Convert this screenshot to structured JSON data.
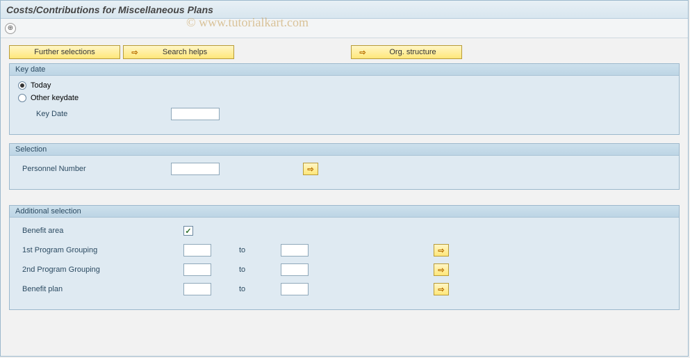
{
  "window": {
    "title": "Costs/Contributions for Miscellaneous Plans"
  },
  "watermark": "© www.tutorialkart.com",
  "buttons": {
    "further_selections": "Further selections",
    "search_helps": "Search helps",
    "org_structure": "Org. structure"
  },
  "group_keydate": {
    "title": "Key date",
    "opt_today": "Today",
    "opt_other": "Other keydate",
    "label_keydate": "Key Date",
    "value_keydate": "",
    "selected": "today"
  },
  "group_selection": {
    "title": "Selection",
    "label_pernr": "Personnel Number",
    "value_pernr": ""
  },
  "group_additional": {
    "title": "Additional selection",
    "rows": {
      "benefit_area": {
        "label": "Benefit area",
        "checked": true
      },
      "pg1": {
        "label": "1st Program Grouping",
        "from": "",
        "to_lbl": "to",
        "to": ""
      },
      "pg2": {
        "label": "2nd Program Grouping",
        "from": "",
        "to_lbl": "to",
        "to": ""
      },
      "bplan": {
        "label": "Benefit plan",
        "from": "",
        "to_lbl": "to",
        "to": ""
      }
    }
  },
  "icons": {
    "arrow": "⇨",
    "check": "✓",
    "f4": "▾",
    "exec": "⊕"
  }
}
